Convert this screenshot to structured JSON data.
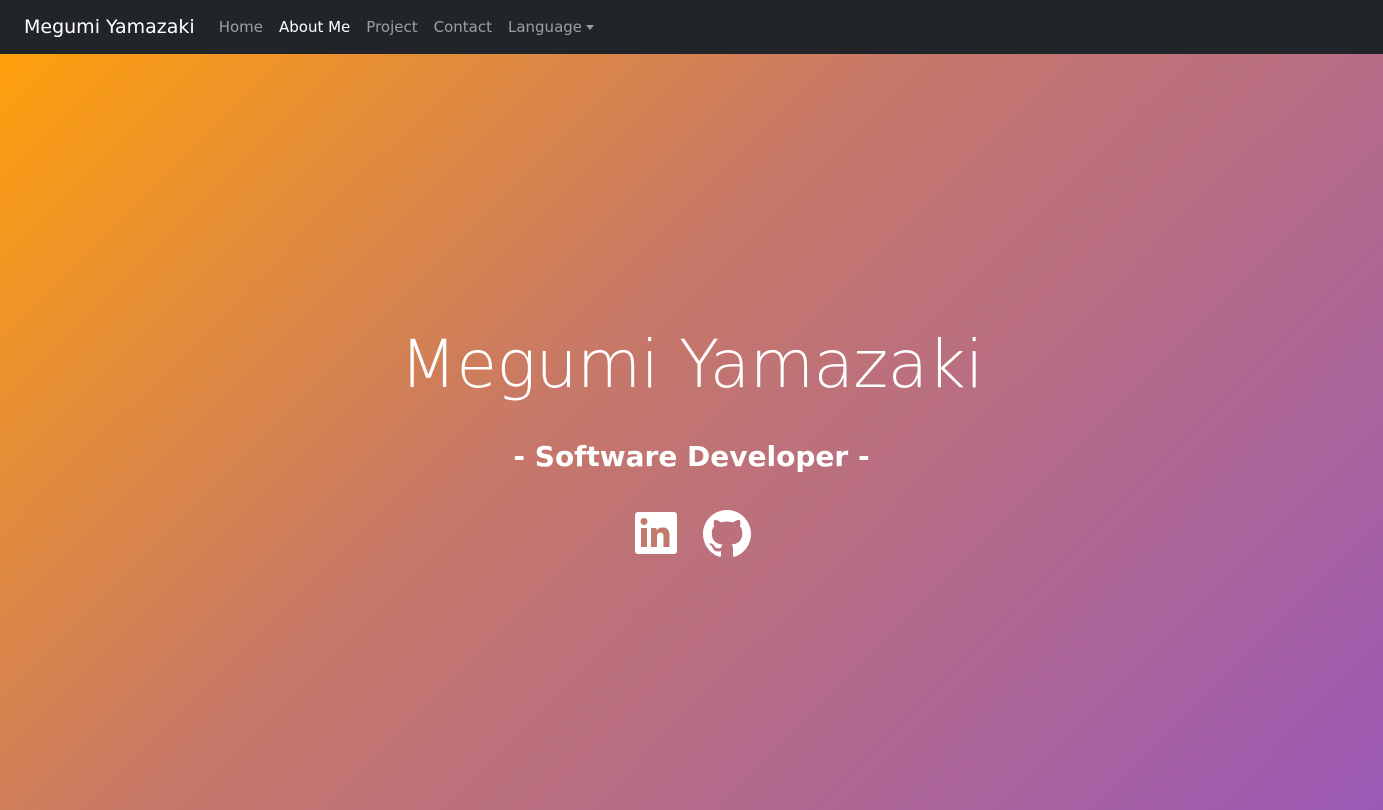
{
  "navbar": {
    "brand": "Megumi Yamazaki",
    "links": [
      {
        "label": "Home",
        "active": false
      },
      {
        "label": "About Me",
        "active": true
      },
      {
        "label": "Project",
        "active": false
      },
      {
        "label": "Contact",
        "active": false
      }
    ],
    "dropdown_label": "Language",
    "background": "#212529"
  },
  "hero": {
    "name": "Megumi Yamazaki",
    "title": "- Software Developer -",
    "gradient": [
      "#ffa00c",
      "#c77868",
      "#9b59b6"
    ],
    "social_icons": [
      "linkedin-icon",
      "github-icon"
    ]
  }
}
